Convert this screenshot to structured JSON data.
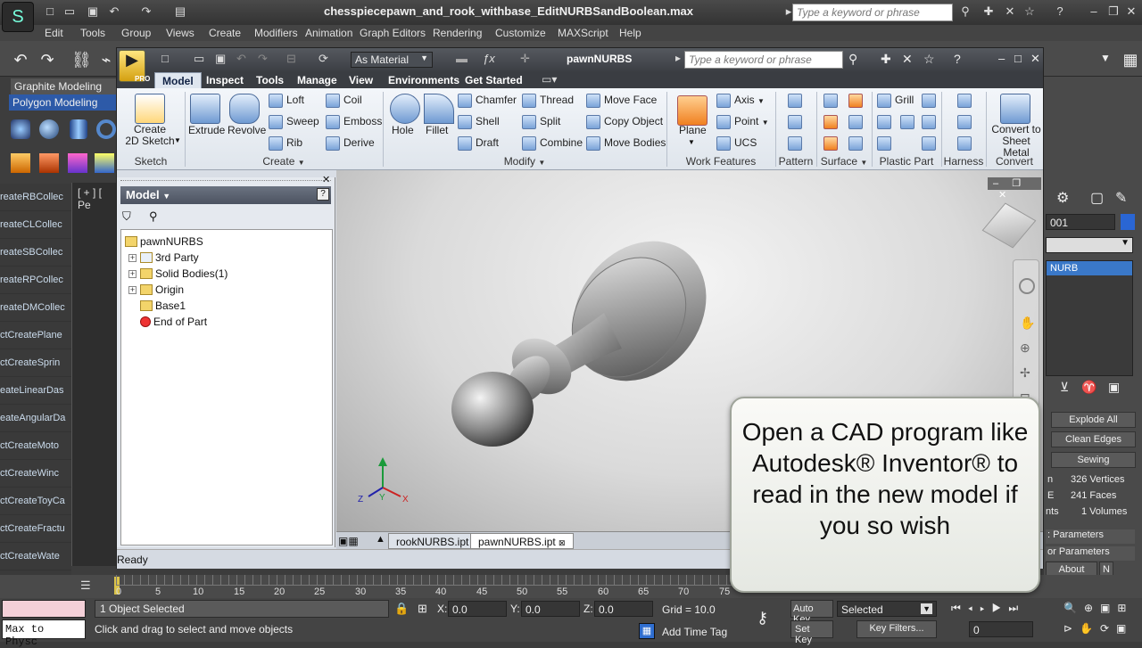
{
  "max": {
    "title": "chesspiecepawn_and_rook_withbase_EditNURBSandBoolean.max",
    "search_placeholder": "Type a keyword or phrase",
    "menu": [
      "Edit",
      "Tools",
      "Group",
      "Views",
      "Create",
      "Modifiers",
      "Animation",
      "Graph Editors",
      "Rendering",
      "Customize",
      "MAXScript",
      "Help"
    ],
    "ribbon_tabs": [
      "Graphite Modeling",
      "Polygon Modeling"
    ],
    "viewport_label": "[ + ] [ Pe",
    "left_commands": [
      "reateRBCollec",
      "reateCLCollec",
      "reateSBCollec",
      "reateRPCollec",
      "reateDMCollec",
      "ctCreatePlane",
      "ctCreateSprin",
      "eateLinearDas",
      "eateAngularDa",
      "ctCreateMoto",
      "ctCreateWinc",
      "ctCreateToyCa",
      "ctCreateFractu",
      "ctCreateWate"
    ],
    "right_panel": {
      "name_field": "001",
      "list_item": "NURB",
      "buttons": [
        "Explode All",
        "Clean Edges",
        "Sewing"
      ],
      "stats": [
        "326 Vertices",
        "241 Faces",
        "1 Volumes"
      ],
      "stat_prefix": [
        "n",
        "E",
        "nts"
      ],
      "rollouts": [
        ": Parameters",
        "or Parameters"
      ],
      "about": "About",
      "n_button": "N"
    },
    "timeline_ticks": [
      "0",
      "5",
      "10",
      "15",
      "20",
      "25",
      "30",
      "35",
      "40",
      "45",
      "50",
      "55",
      "60",
      "65",
      "70",
      "75"
    ],
    "status": {
      "script_box": "Max to Physc",
      "selection": "1 Object Selected",
      "prompt": "Click and drag to select and move objects",
      "x_label": "X:",
      "x_value": "0.0",
      "y_label": "Y:",
      "y_value": "0.0",
      "z_label": "Z:",
      "z_value": "0.0",
      "grid": "Grid = 10.0",
      "add_time_tag": "Add Time Tag",
      "auto_key": "Auto Key",
      "set_key": "Set Key",
      "selected_dropdown": "Selected",
      "key_filters": "Key Filters...",
      "frame_value": "0"
    }
  },
  "inventor": {
    "material": "As Material",
    "doc_title": "pawnNURBS",
    "search_placeholder": "Type a keyword or phrase",
    "pro_badge": "PRO",
    "tabs": [
      "Model",
      "Inspect",
      "Tools",
      "Manage",
      "View",
      "Environments",
      "Get Started"
    ],
    "ribbon": {
      "sketch": {
        "button": "Create\n2D Sketch",
        "group": "Sketch"
      },
      "create": {
        "extrude": "Extrude",
        "revolve": "Revolve",
        "loft": "Loft",
        "sweep": "Sweep",
        "rib": "Rib",
        "coil": "Coil",
        "emboss": "Emboss",
        "derive": "Derive",
        "group": "Create"
      },
      "modify": {
        "hole": "Hole",
        "fillet": "Fillet",
        "chamfer": "Chamfer",
        "shell": "Shell",
        "draft": "Draft",
        "thread": "Thread",
        "split": "Split",
        "combine": "Combine",
        "move_face": "Move Face",
        "copy_object": "Copy Object",
        "move_bodies": "Move Bodies",
        "group": "Modify"
      },
      "work": {
        "plane": "Plane",
        "axis": "Axis",
        "point": "Point",
        "ucs": "UCS",
        "group": "Work Features"
      },
      "pattern": {
        "group": "Pattern"
      },
      "surface": {
        "group": "Surface"
      },
      "plastic": {
        "grill": "Grill",
        "group": "Plastic Part"
      },
      "harness": {
        "group": "Harness"
      },
      "convert": {
        "button": "Convert to\nSheet Metal",
        "group": "Convert"
      }
    },
    "browser": {
      "title": "Model",
      "tree": [
        {
          "label": "pawnNURBS",
          "level": 0,
          "expander": ""
        },
        {
          "label": "3rd Party",
          "level": 1,
          "expander": "+"
        },
        {
          "label": "Solid Bodies(1)",
          "level": 1,
          "expander": "+"
        },
        {
          "label": "Origin",
          "level": 1,
          "expander": "+"
        },
        {
          "label": "Base1",
          "level": 1,
          "expander": ""
        },
        {
          "label": "End of Part",
          "level": 1,
          "expander": ""
        }
      ]
    },
    "doc_tabs": [
      "rookNURBS.ipt",
      "pawnNURBS.ipt"
    ],
    "status": "Ready",
    "triad": {
      "x": "X",
      "y": "Y",
      "z": "Z"
    }
  },
  "caption": "Open a CAD program like Autodesk® Inventor® to read in the new model if you so wish",
  "colors": {
    "caption_bg": "#f2f4ef",
    "ribbon_bg": "#e8edf3",
    "max_bg": "#3c3c3c"
  }
}
